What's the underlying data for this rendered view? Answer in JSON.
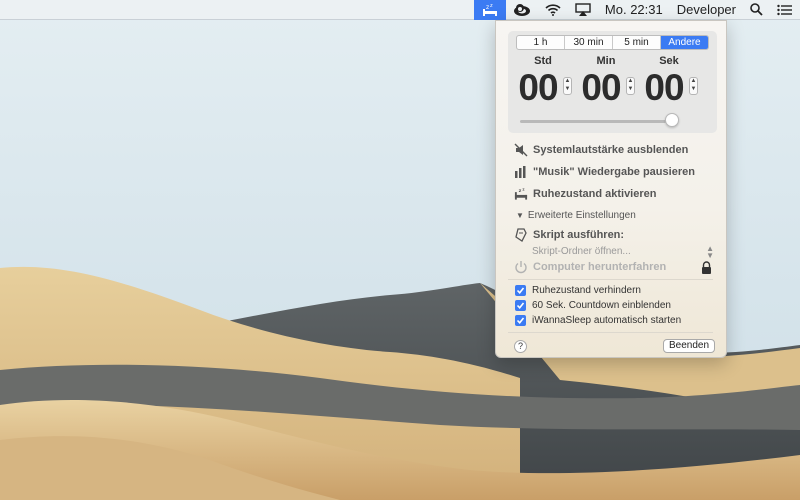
{
  "menubar": {
    "clock": "Mo. 22:31",
    "user": "Developer",
    "icons": [
      "iwannasleep-icon",
      "creative-cloud-icon",
      "wifi-icon",
      "airplay-icon",
      "spotlight-search-icon",
      "notification-center-icon"
    ],
    "highlight_color": "#3b7bf3"
  },
  "panel": {
    "presets": [
      "1 h",
      "30 min",
      "5 min",
      "Andere"
    ],
    "selected_preset": "Andere",
    "timer": {
      "hours_label": "Std",
      "minutes_label": "Min",
      "seconds_label": "Sek",
      "hours": "00",
      "minutes": "00",
      "seconds": "00"
    },
    "slider_value": 1.0,
    "actions": {
      "mute": "Systemlautstärke ausblenden",
      "pause_music": "\"Musik\" Wiedergabe pausieren",
      "sleep": "Ruhezustand aktivieren"
    },
    "advanced_label": "Erweiterte Einstellungen",
    "script_label": "Skript ausführen:",
    "script_select": "Skript-Ordner öffnen...",
    "shutdown_label": "Computer herunterfahren",
    "checkboxes": [
      {
        "label": "Ruhezustand verhindern",
        "checked": true
      },
      {
        "label": "60 Sek. Countdown einblenden",
        "checked": true
      },
      {
        "label": "iWannaSleep automatisch starten",
        "checked": true
      }
    ],
    "help_label": "?",
    "quit_label": "Beenden",
    "accent_color": "#3b7bf3"
  }
}
